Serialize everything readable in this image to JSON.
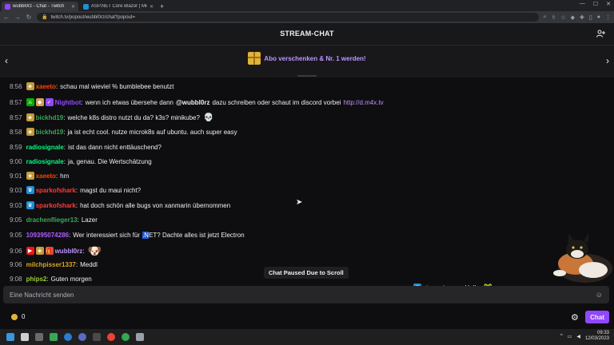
{
  "browser": {
    "tabs": [
      {
        "label": "wubbl0rz - Chat - Twitch",
        "color": "#9147ff",
        "active": true
      },
      {
        "label": "ASP.NET Core Blazor | Microsoft",
        "color": "#1e8fd6",
        "active": false
      }
    ],
    "url": "twitch.tv/popout/wubbl0rz/chat?popout="
  },
  "header": {
    "title": "STREAM-CHAT"
  },
  "banner": {
    "text": "Abo verschenken & Nr. 1 werden!"
  },
  "messages": [
    {
      "time": "8:56",
      "user": "xaeeto",
      "color": "#ff4500",
      "text": "schau mal wieviel % bumblebee benutzt"
    },
    {
      "time": "8:57",
      "user": "Nightbot",
      "color": "#9147ff",
      "text_before": "wenn ich etwas übersehe dann",
      "mention": "@wubbl0rz",
      "text_after": "dazu schreiben oder schaut im discord vorbei",
      "link": "http://d.m4x.tv"
    },
    {
      "time": "8:57",
      "user": "bickhd19",
      "color": "#3aa757",
      "text": "welche k8s distro nutzt du da? k3s? minikube?"
    },
    {
      "time": "8:58",
      "user": "bickhd19",
      "color": "#3aa757",
      "text": "ja ist echt cool. nutze microk8s auf ubuntu. auch super easy"
    },
    {
      "time": "8:59",
      "user": "radiosignale",
      "color": "#00ff7f",
      "text": "ist das dann nicht enttäuschend?"
    },
    {
      "time": "9:00",
      "user": "radiosignale",
      "color": "#00ff7f",
      "text": "ja, genau. Die Wertschätzung"
    },
    {
      "time": "9:01",
      "user": "xaeeto",
      "color": "#ff4500",
      "text": "hm"
    },
    {
      "time": "9:03",
      "user": "sparkofshark",
      "color": "#ff3b3b",
      "text": "magst du maui nicht?"
    },
    {
      "time": "9:03",
      "user": "sparkofshark",
      "color": "#ff3b3b",
      "text": "hat doch schön alle bugs von xanmarin übernommen"
    },
    {
      "time": "9:05",
      "user": "drachenflieger13",
      "color": "#3aa757",
      "text": "Lazer"
    },
    {
      "time": "9:05",
      "user": "109395074286",
      "color": "#b05cff",
      "text_before": "Wer interessiert sich für",
      "selected": ".N",
      "text_after": "ET? Dachte alles ist jetzt Electron"
    },
    {
      "time": "9:06",
      "user": "wubbl0rz",
      "color": "#bf94ff",
      "text": ""
    },
    {
      "time": "9:06",
      "user": "milchpisser1337",
      "color": "#daa520",
      "text": "Meddl"
    },
    {
      "time": "9:08",
      "user": "phips2",
      "color": "#9acd32",
      "text": "Guten morgen"
    }
  ],
  "paused_text": "Chat Paused Due to Scroll",
  "overlay": {
    "user": "ziegenkaese",
    "color": "#ff4500",
    "text": "Hallo"
  },
  "input": {
    "placeholder": "Eine Nachricht senden",
    "value": ""
  },
  "points": {
    "value": "0"
  },
  "chat_button": "Chat",
  "taskbar": {
    "time": "09:33",
    "date": "12/03/2023"
  },
  "colors": {
    "accent": "#9147ff",
    "background": "#0e0e10",
    "panel": "#18181b"
  }
}
